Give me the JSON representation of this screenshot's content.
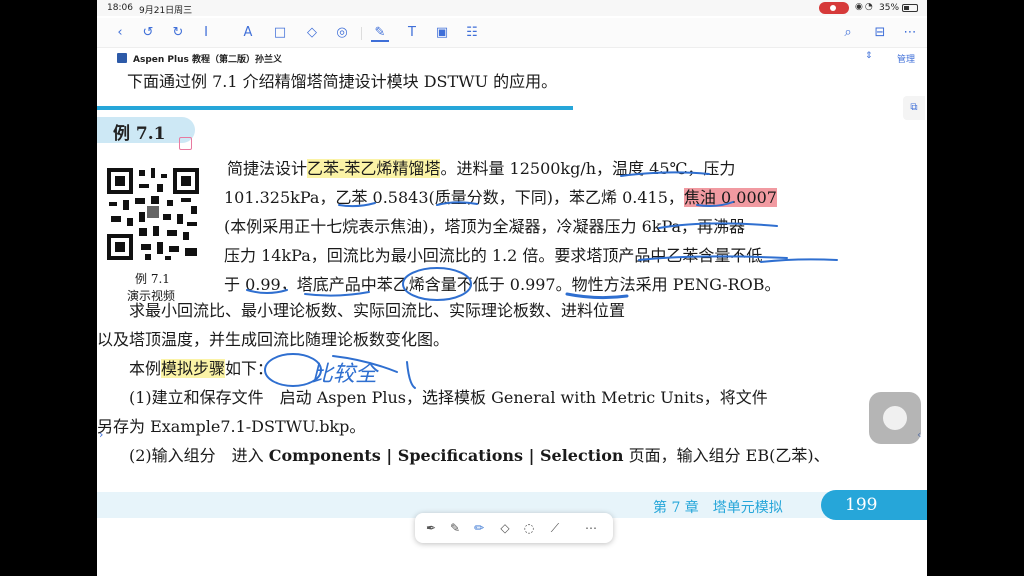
{
  "status": {
    "time": "18:06",
    "date": "9月21日周三",
    "battery": "35%"
  },
  "toolbar": {
    "icons": [
      "back-icon",
      "undo-icon",
      "redo-icon",
      "text-select-icon",
      "highlight-icon",
      "shape-icon",
      "eraser-icon",
      "lasso-icon",
      "pen-icon",
      "textbox-icon",
      "image-icon",
      "more-tools-icon",
      "search-icon",
      "bookmark-icon",
      "more-icon"
    ]
  },
  "document": {
    "title": "Aspen Plus 教程（第二版）孙兰义",
    "manage": "管理"
  },
  "page": {
    "intro": "下面通过例 7.1 介绍精馏塔简捷设计模块 DSTWU 的应用。",
    "example_label": "例 7.1",
    "qr_caption_1": "例 7.1",
    "qr_caption_2": "演示视频",
    "p1": {
      "l1a": "简捷法设计",
      "l1b": "乙苯-苯乙烯精馏塔",
      "l1c": "。进料量 12500kg/h，温度 45℃，压力",
      "l2a": "101.325kPa，乙苯 0.5843(质量分数，下同)，苯乙烯 0.415，",
      "l2b": "焦油 0.0007",
      "l3": "(本例采用正十七烷表示焦油)，塔顶为全凝器，冷凝器压力 6kPa，再沸器",
      "l4": "压力 14kPa，回流比为最小回流比的 1.2 倍。要求塔顶产品中乙苯含量不低",
      "l5": "于 0.99，塔底产品中苯乙烯含量不低于 0.997。物性方法采用 PENG-ROB。"
    },
    "p2": {
      "l1": "　　求最小回流比、最小理论板数、实际回流比、实际理论板数、进料位置",
      "l2": "以及塔顶温度，并生成回流比随理论板数变化图。",
      "l3a": "　　本例",
      "l3b": "模拟步骤",
      "l3c": "如下：",
      "l4": "　　(1)建立和保存文件　启动 Aspen Plus，选择模板 General with Metric Units，将文件",
      "l5": "另存为 Example7.1-DSTWU.bkp。",
      "l6a": "　　(2)输入组分　进入 ",
      "l6b": "Components | Specifications | Selection",
      "l6c": " 页面，输入组分 EB(乙苯)、"
    },
    "handwriting": "比较全",
    "footer_chapter": "第 7 章　塔单元模拟",
    "page_number": "199"
  }
}
